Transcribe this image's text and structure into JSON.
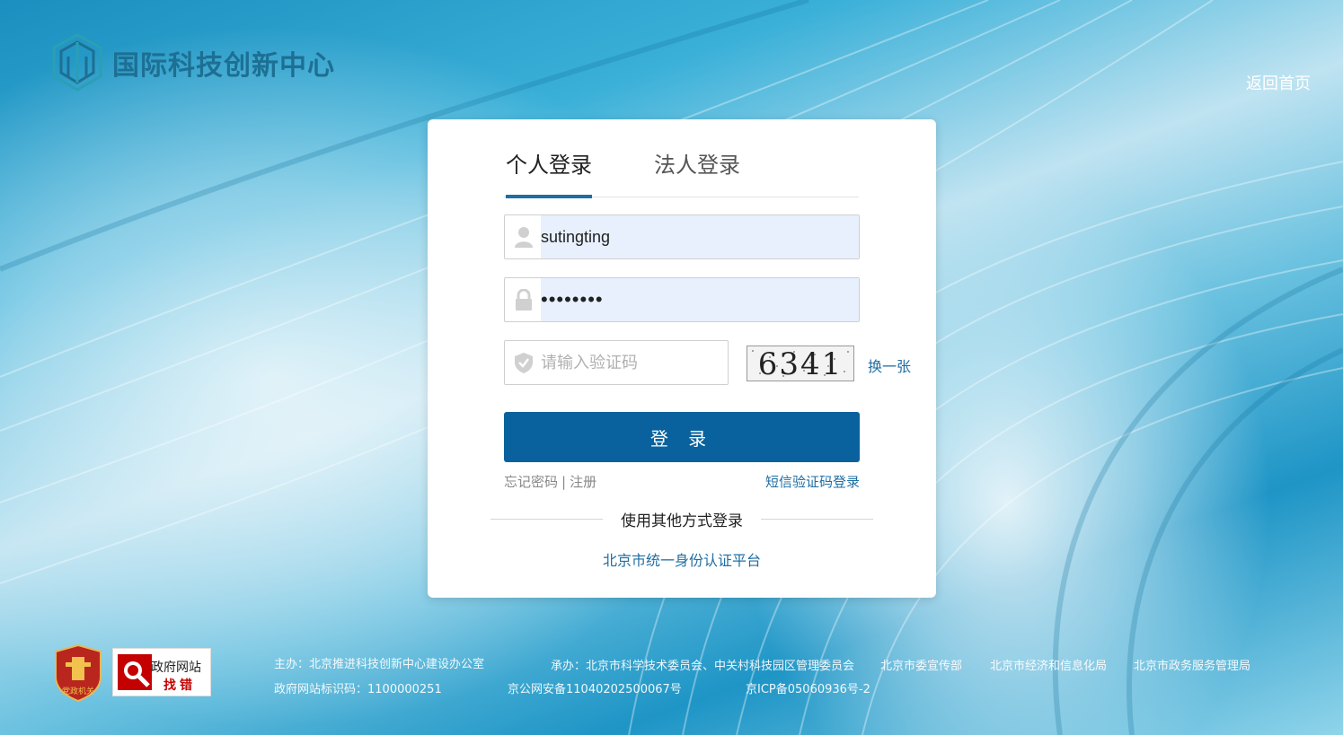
{
  "header": {
    "logo_text": "国际科技创新中心",
    "home_link": "返回首页"
  },
  "login": {
    "tabs": [
      {
        "label": "个人登录",
        "active": true
      },
      {
        "label": "法人登录",
        "active": false
      }
    ],
    "username_value": "sutingting",
    "password_value": "••••••••",
    "captcha_placeholder": "请输入验证码",
    "captcha_text": "6341",
    "refresh_label": "换一张",
    "submit_label": "登 录",
    "forgot_label": "忘记密码",
    "separator": "|",
    "register_label": "注册",
    "sms_login_label": "短信验证码登录",
    "other_methods_label": "使用其他方式登录",
    "unified_auth_label": "北京市统一身份认证平台"
  },
  "footer": {
    "party_badge_label": "党政机关",
    "gov_badge_line1": "政府网站",
    "gov_badge_line2": "找错",
    "host": "主办：北京推进科技创新中心建设办公室",
    "organizer": "承办：北京市科学技术委员会、中关村科技园区管理委员会",
    "dept1": "北京市委宣传部",
    "dept2": "北京市经济和信息化局",
    "dept3": "北京市政务服务管理局",
    "site_id": "政府网站标识码：1100000251",
    "police": "京公网安备11040202500067号",
    "icp": "京ICP备05060936号-2"
  },
  "colors": {
    "brand": "#09629d",
    "link": "#1f6ea3",
    "logo": "#1d6f93"
  }
}
